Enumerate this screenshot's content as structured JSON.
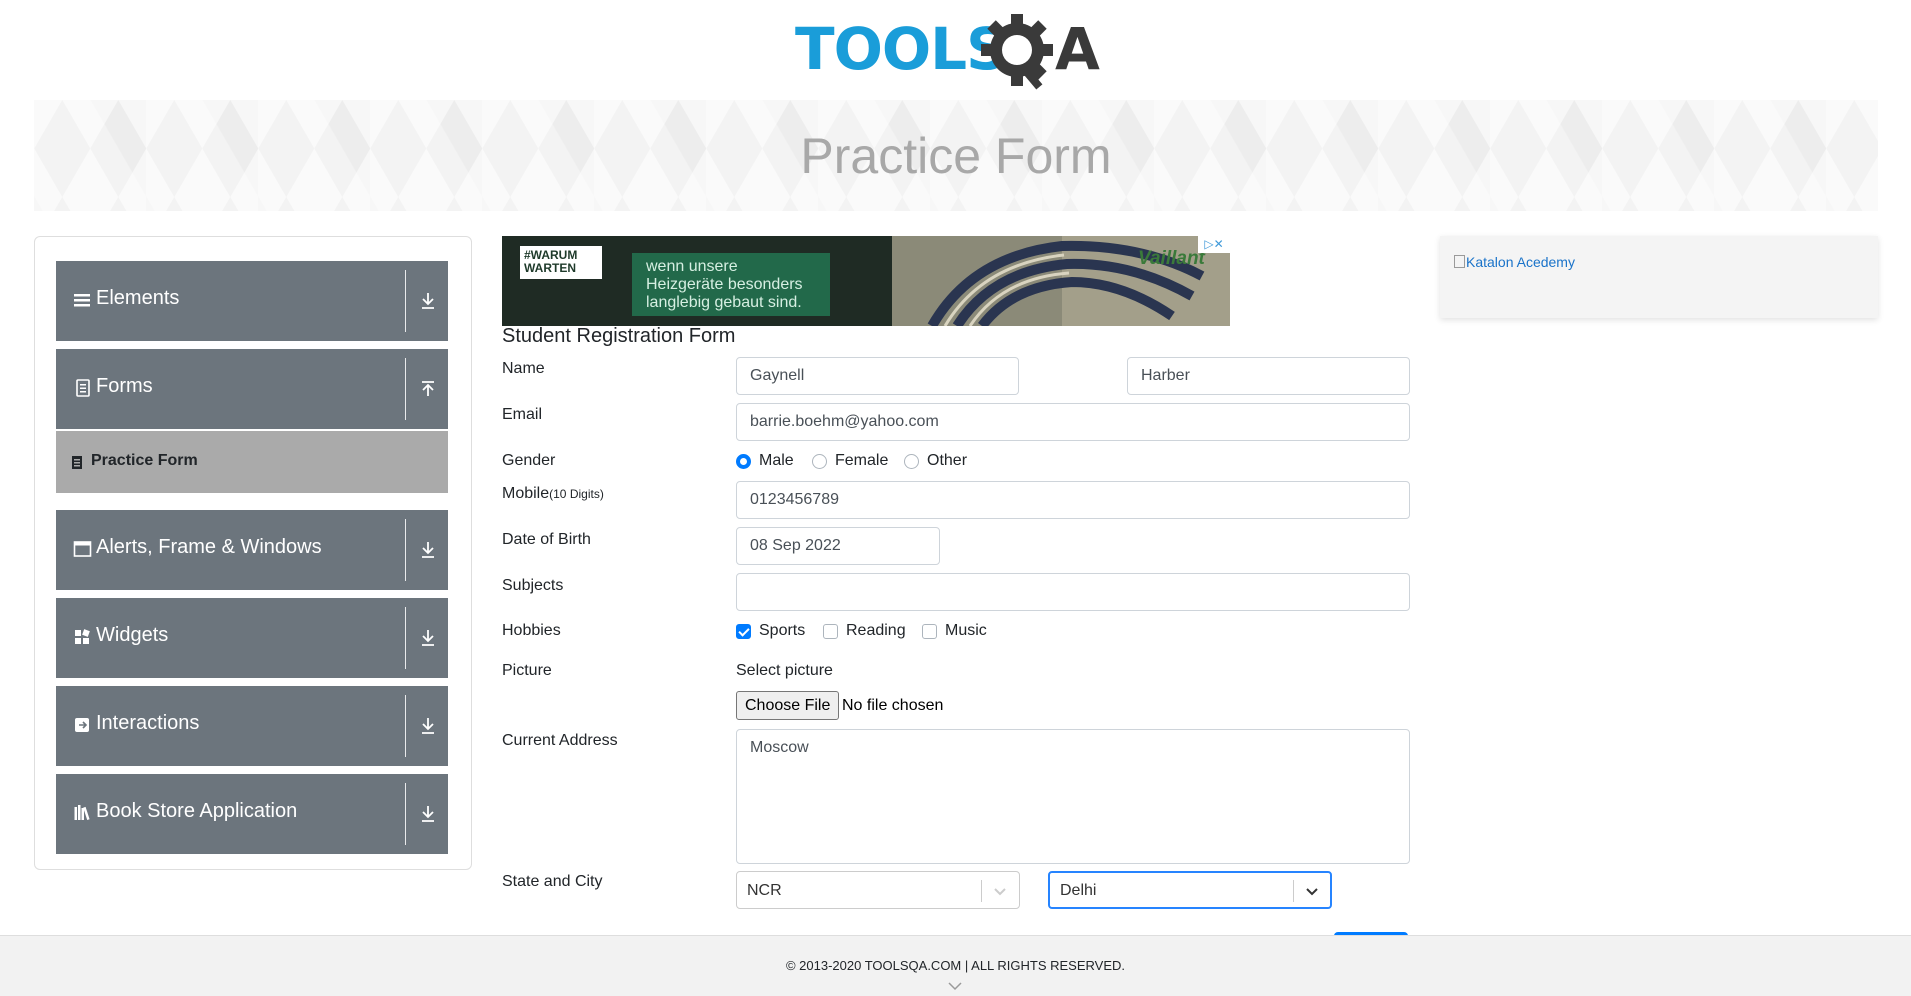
{
  "logo": {
    "text_part1": "TOOLS",
    "text_part2": "QA",
    "color_blue": "#1a9dd9",
    "color_dark": "#3a3a3a"
  },
  "header": {
    "title": "Practice Form"
  },
  "sidebar": {
    "groups": [
      {
        "label": "Elements",
        "icon": "hamburger-icon",
        "toggle": "download-arrow-icon"
      },
      {
        "label": "Forms",
        "icon": "document-icon",
        "toggle": "upload-arrow-icon"
      },
      {
        "label": "Alerts, Frame & Windows",
        "icon": "window-icon",
        "toggle": "download-arrow-icon"
      },
      {
        "label": "Widgets",
        "icon": "widgets-icon",
        "toggle": "download-arrow-icon"
      },
      {
        "label": "Interactions",
        "icon": "interactions-icon",
        "toggle": "download-arrow-icon"
      },
      {
        "label": "Book Store Application",
        "icon": "books-icon",
        "toggle": "download-arrow-icon"
      }
    ],
    "active_item": {
      "label": "Practice Form",
      "icon": "form-icon"
    },
    "colors": {
      "group_bg": "#6c757d",
      "active_bg": "#aaaaaa"
    }
  },
  "ad": {
    "badge": "#WARUM WARTEN",
    "text": "wenn unsere Heizgeräte besonders langlebig gebaut sind.",
    "brand": "Vaillant",
    "close": "▷✕"
  },
  "form": {
    "title": "Student Registration Form",
    "labels": {
      "name": "Name",
      "email": "Email",
      "gender": "Gender",
      "mobile": "Mobile",
      "mobile_hint": "(10 Digits)",
      "dob": "Date of Birth",
      "subjects": "Subjects",
      "hobbies": "Hobbies",
      "picture": "Picture",
      "current_address": "Current Address",
      "state_city": "State and City"
    },
    "first_name": "Gaynell",
    "last_name": "Harber",
    "email": "barrie.boehm@yahoo.com",
    "gender_options": [
      {
        "label": "Male",
        "checked": true
      },
      {
        "label": "Female",
        "checked": false
      },
      {
        "label": "Other",
        "checked": false
      }
    ],
    "mobile": "0123456789",
    "dob": "08 Sep 2022",
    "subjects": "",
    "hobbies": [
      {
        "label": "Sports",
        "checked": true
      },
      {
        "label": "Reading",
        "checked": false
      },
      {
        "label": "Music",
        "checked": false
      }
    ],
    "select_picture": "Select picture",
    "choose_file": "Choose File",
    "file_status": "No file chosen",
    "current_address": "Moscow",
    "state": "NCR",
    "city": "Delhi",
    "accent_color": "#007bff"
  },
  "side_ad": {
    "alt": "Katalon Acedemy"
  },
  "footer": {
    "copyright": "© 2013-2020 TOOLSQA.COM | ALL RIGHTS RESERVED."
  }
}
